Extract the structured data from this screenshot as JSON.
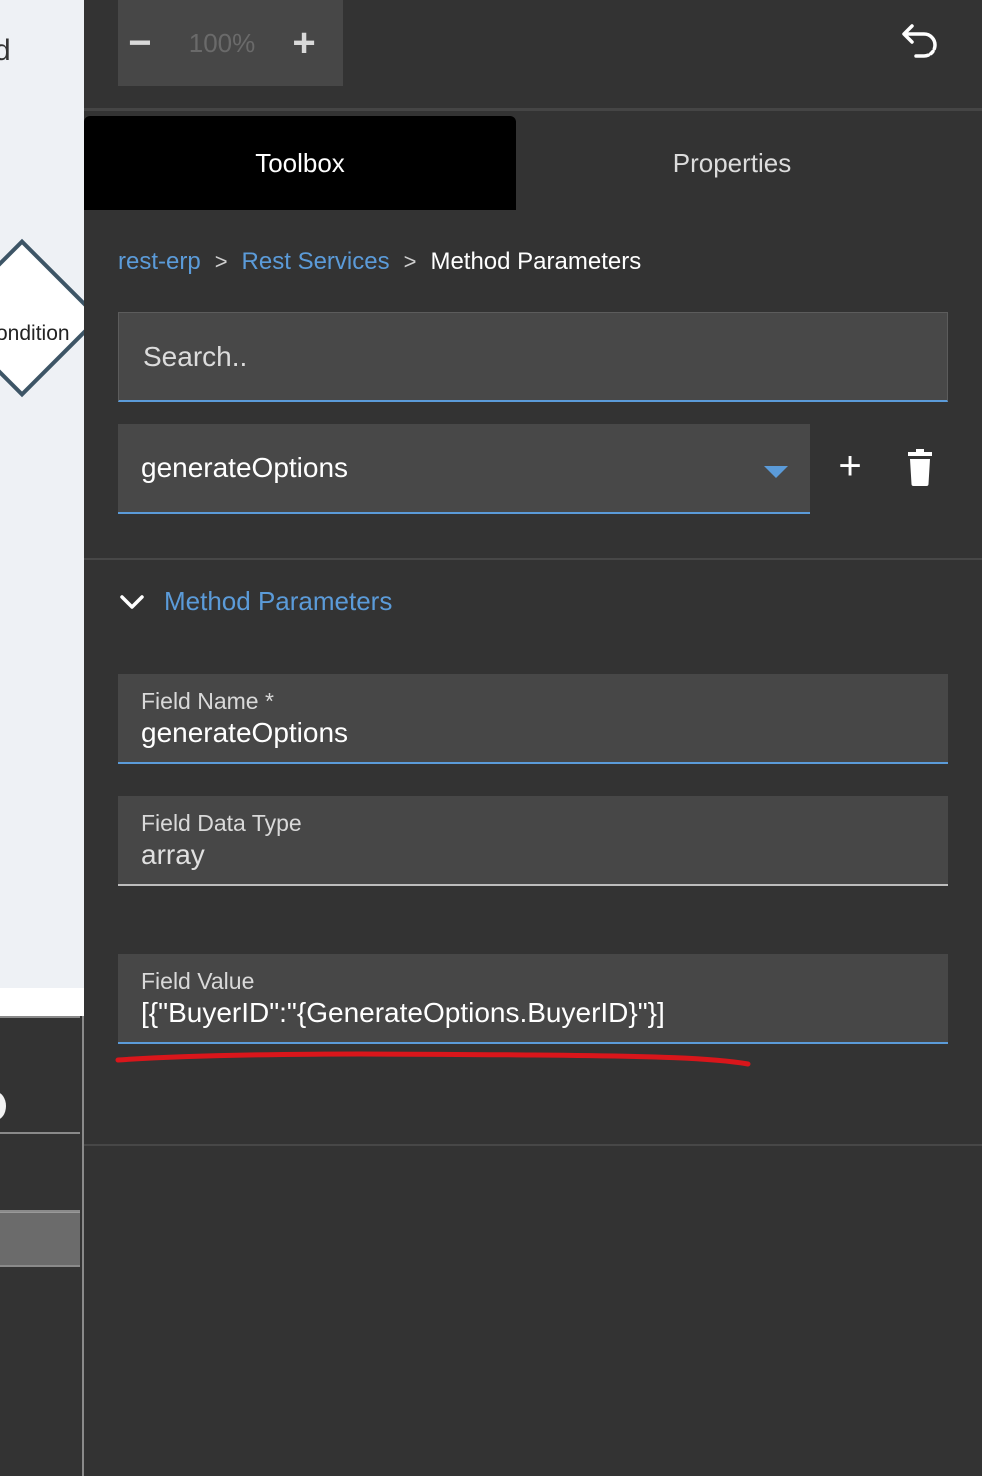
{
  "canvas": {
    "cut_text": "d",
    "condition_label": "ondition"
  },
  "zoom": {
    "minus_label": "−",
    "value": "100%",
    "plus_label": "+"
  },
  "tabs": [
    {
      "label": "Toolbox",
      "active": true
    },
    {
      "label": "Properties",
      "active": false
    }
  ],
  "breadcrumb": {
    "items": [
      "rest-erp",
      "Rest Services"
    ],
    "current": "Method Parameters",
    "separator": ">"
  },
  "search": {
    "placeholder": "Search.."
  },
  "selector": {
    "value": "generateOptions",
    "add_label": "+"
  },
  "section": {
    "title": "Method Parameters"
  },
  "fields": {
    "field_name": {
      "label": "Field Name *",
      "value": "generateOptions"
    },
    "field_data_type": {
      "label": "Field Data Type",
      "value": "array"
    },
    "field_value": {
      "label": "Field Value",
      "value": "[{\"BuyerID\":\"{GenerateOptions.BuyerID}\"}]"
    }
  },
  "colors": {
    "background": "#333333",
    "accent": "#5b9bd9",
    "active_tab": "#000000",
    "annotation": "#d9161b"
  }
}
